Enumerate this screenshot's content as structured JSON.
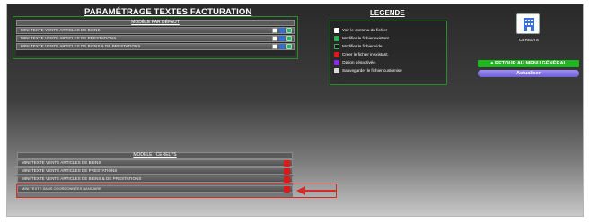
{
  "page": {
    "title": "PARAMÉTRAGE TEXTES FACTURATION"
  },
  "default_panel": {
    "header": "MODÈLE PAR DÉFAUT",
    "rows": [
      {
        "label": "MINI TEXTE VENTE ARTICLES DE BIENS"
      },
      {
        "label": "MINI TEXTE VENTE ARTICLES DE PRESTATIONS"
      },
      {
        "label": "MINI TEXTE VENTE ARTICLES DE BIENS & DE PRESTATIONS"
      }
    ]
  },
  "company_panel": {
    "header": "MODÈLE / CERELYS",
    "rows": [
      {
        "label": "MINI TEXTE VENTE ARTICLES DE BIENS"
      },
      {
        "label": "MINI TEXTE VENTE ARTICLES DE PRESTATIONS"
      },
      {
        "label": "MINI TEXTE VENTE ARTICLES DE BIENS & DE PRESTATIONS"
      },
      {
        "label": "MINI TEXTE SANS COORDONNÉES BANCAIRE"
      }
    ]
  },
  "legend": {
    "title": "LEGENDE",
    "items": [
      {
        "label": "Voir le contenu du fichier",
        "icon": "eye-icon",
        "color": "#ffffff"
      },
      {
        "label": "Modifier le fichier existant.",
        "icon": "edit-icon",
        "color": "#2fae5a"
      },
      {
        "label": "Modifier le fichier vide",
        "icon": "edit-empty-icon",
        "color": "#1a1a1a"
      },
      {
        "label": "Créer le fichier inexistant.",
        "icon": "create-icon",
        "color": "#e01818"
      },
      {
        "label": "Option désactivée.",
        "icon": "disabled-icon",
        "color": "#8a2be2"
      },
      {
        "label": "Sauvegarder le fichier customisé",
        "icon": "save-icon",
        "color": "#d8d8d8"
      }
    ]
  },
  "company": {
    "name": "CERELYS",
    "logo_icon": "building-icon"
  },
  "buttons": {
    "return_menu": "RETOUR AU MENU GÉNÉRAL",
    "refresh": "Actualiser"
  },
  "colors": {
    "panel_border": "#2c8a2c",
    "return_button": "#1db81d",
    "refresh_button": "#6f5fd8",
    "highlight": "#d42a2a"
  }
}
